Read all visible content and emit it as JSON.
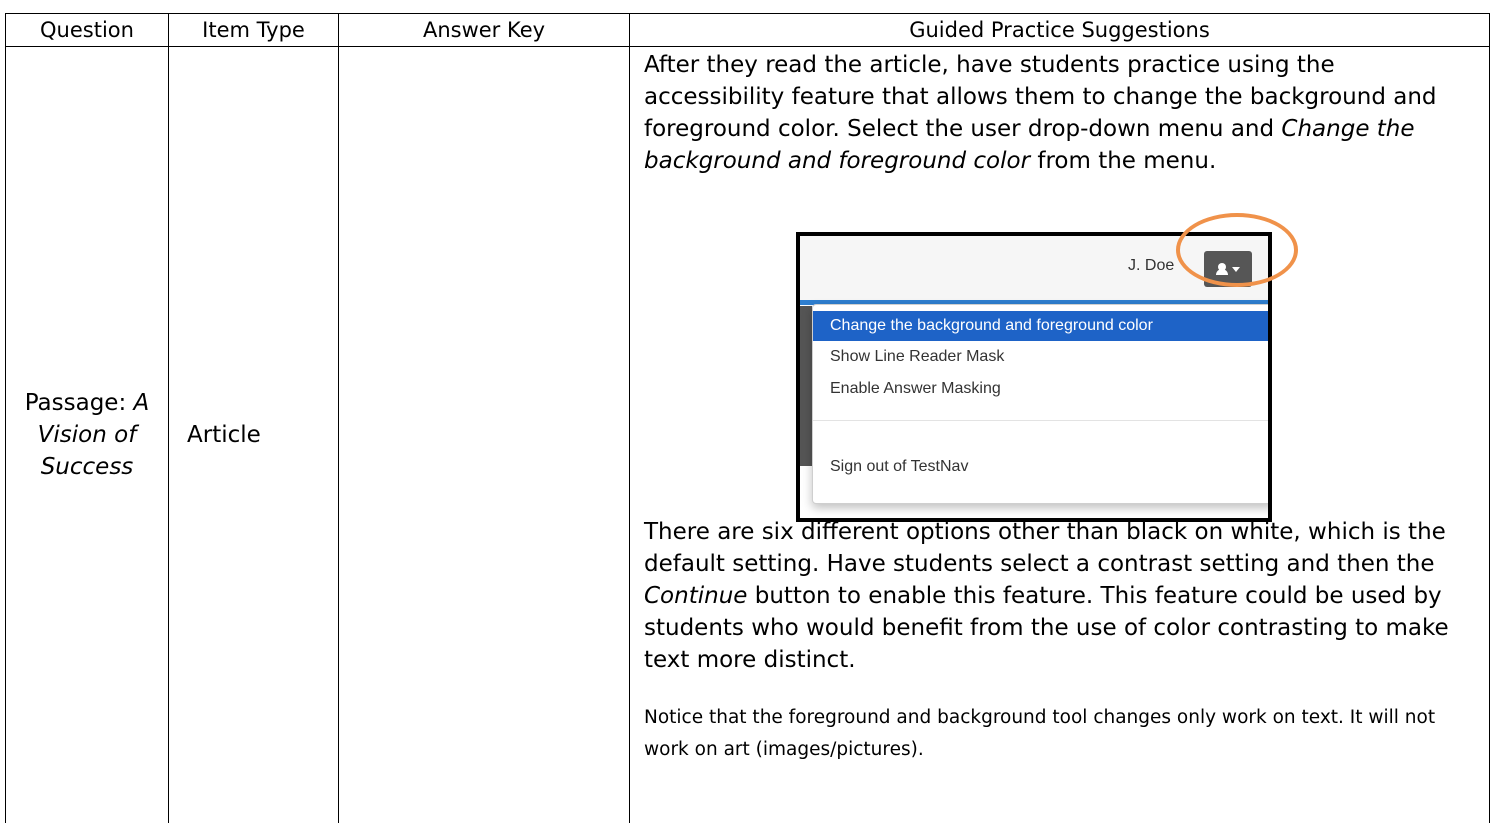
{
  "table": {
    "headers": [
      "Question",
      "Item Type",
      "Answer Key",
      "Guided Practice Suggestions"
    ],
    "row": {
      "question": {
        "prefix": "Passage: ",
        "title_line1": "A",
        "title_line2": "Vision of",
        "title_line3": "Success"
      },
      "item_type": "Article",
      "answer_key": "",
      "guided": {
        "para1_a": "After they read the article, have students practice using the accessibility feature that allows them to change the background and foreground color.  Select the user drop-down menu and ",
        "para1_em": "Change the background and foreground color",
        "para1_b": " from the menu.",
        "para2_a": "There are six different options other than black on white, which is the default setting.  Have students select a contrast setting and then the ",
        "para2_em": "Continue",
        "para2_b": " button to enable this feature. This feature could be used by students who would benefit from the use of color contrasting to make text more distinct.",
        "note": "Notice that the foreground and background tool changes only work on text. It will not work on art (images/pictures)."
      }
    }
  },
  "screenshot": {
    "user_name": "J. Doe",
    "user_icon": "user-icon",
    "menu_items": [
      "Change the background and foreground color",
      "Show Line Reader Mask",
      "Enable Answer Masking",
      "Sign out of TestNav"
    ],
    "active_color": "#1e63c7",
    "highlight_color": "#f0924a"
  }
}
